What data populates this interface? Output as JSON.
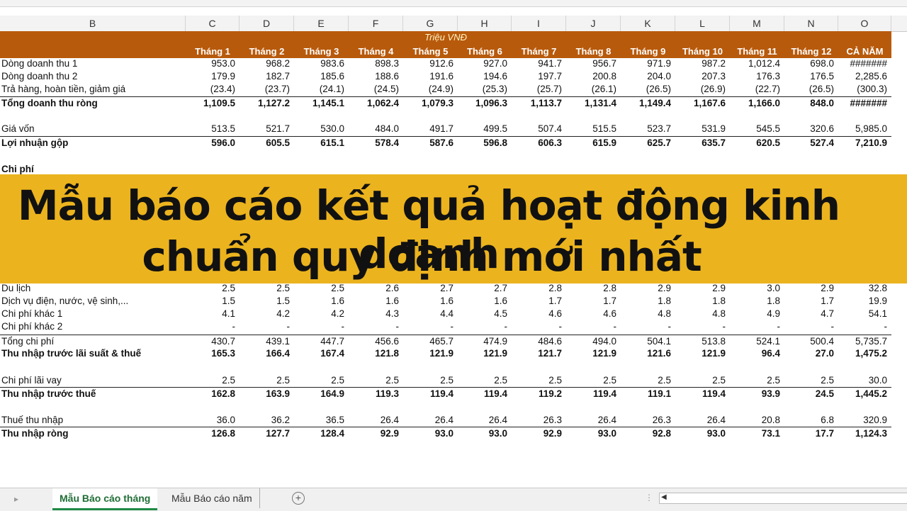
{
  "columns": [
    "B",
    "C",
    "D",
    "E",
    "F",
    "G",
    "H",
    "I",
    "J",
    "K",
    "L",
    "M",
    "N",
    "O"
  ],
  "unit_label": "Triệu VNĐ",
  "month_headers": [
    "Tháng 1",
    "Tháng 2",
    "Tháng 3",
    "Tháng 4",
    "Tháng 5",
    "Tháng 6",
    "Tháng 7",
    "Tháng 8",
    "Tháng 9",
    "Tháng 10",
    "Tháng 11",
    "Tháng 12",
    "CẢ NĂM"
  ],
  "rows_top": [
    {
      "label": "Dòng doanh thu 1",
      "values": [
        "953.0",
        "968.2",
        "983.6",
        "898.3",
        "912.6",
        "927.0",
        "941.7",
        "956.7",
        "971.9",
        "987.2",
        "1,012.4",
        "698.0",
        "#######"
      ]
    },
    {
      "label": "Dòng doanh thu 2",
      "values": [
        "179.9",
        "182.7",
        "185.6",
        "188.6",
        "191.6",
        "194.6",
        "197.7",
        "200.8",
        "204.0",
        "207.3",
        "176.3",
        "176.5",
        "2,285.6"
      ]
    },
    {
      "label": "Trả hàng, hoàn tiền, giảm giá",
      "values": [
        "(23.4)",
        "(23.7)",
        "(24.1)",
        "(24.5)",
        "(24.9)",
        "(25.3)",
        "(25.7)",
        "(26.1)",
        "(26.5)",
        "(26.9)",
        "(22.7)",
        "(26.5)",
        "(300.3)"
      ]
    },
    {
      "label": "Tổng doanh thu ròng",
      "values": [
        "1,109.5",
        "1,127.2",
        "1,145.1",
        "1,062.4",
        "1,079.3",
        "1,096.3",
        "1,113.7",
        "1,131.4",
        "1,149.4",
        "1,167.6",
        "1,166.0",
        "848.0",
        "#######"
      ]
    },
    {
      "label": "Giá vốn",
      "values": [
        "513.5",
        "521.7",
        "530.0",
        "484.0",
        "491.7",
        "499.5",
        "507.4",
        "515.5",
        "523.7",
        "531.9",
        "545.5",
        "320.6",
        "5,985.0"
      ]
    },
    {
      "label": "Lợi nhuận gộp",
      "values": [
        "596.0",
        "605.5",
        "615.1",
        "578.4",
        "587.6",
        "596.8",
        "606.3",
        "615.9",
        "625.7",
        "635.7",
        "620.5",
        "527.4",
        "7,210.9"
      ]
    },
    {
      "label": "Chi phí",
      "values": []
    }
  ],
  "rows_bottom": [
    {
      "label": "Du lịch",
      "values": [
        "2.5",
        "2.5",
        "2.5",
        "2.6",
        "2.7",
        "2.7",
        "2.8",
        "2.8",
        "2.9",
        "2.9",
        "3.0",
        "2.9",
        "32.8"
      ]
    },
    {
      "label": "Dịch vụ điện, nước, vệ sinh,...",
      "values": [
        "1.5",
        "1.5",
        "1.6",
        "1.6",
        "1.6",
        "1.6",
        "1.7",
        "1.7",
        "1.8",
        "1.8",
        "1.8",
        "1.7",
        "19.9"
      ]
    },
    {
      "label": "Chi phí khác 1",
      "values": [
        "4.1",
        "4.2",
        "4.2",
        "4.3",
        "4.4",
        "4.5",
        "4.6",
        "4.6",
        "4.8",
        "4.8",
        "4.9",
        "4.7",
        "54.1"
      ]
    },
    {
      "label": "Chi phí khác 2",
      "values": [
        "-",
        "-",
        "-",
        "-",
        "-",
        "-",
        "-",
        "-",
        "-",
        "-",
        "-",
        "-",
        "-"
      ]
    },
    {
      "label": "Tổng chi phí",
      "values": [
        "430.7",
        "439.1",
        "447.7",
        "456.6",
        "465.7",
        "474.9",
        "484.6",
        "494.0",
        "504.1",
        "513.8",
        "524.1",
        "500.4",
        "5,735.7"
      ]
    },
    {
      "label": "Thu nhập trước lãi suất & thuế",
      "values": [
        "165.3",
        "166.4",
        "167.4",
        "121.8",
        "121.9",
        "121.9",
        "121.7",
        "121.9",
        "121.6",
        "121.9",
        "96.4",
        "27.0",
        "1,475.2"
      ]
    },
    {
      "label": "Chi phí lãi vay",
      "values": [
        "2.5",
        "2.5",
        "2.5",
        "2.5",
        "2.5",
        "2.5",
        "2.5",
        "2.5",
        "2.5",
        "2.5",
        "2.5",
        "2.5",
        "30.0"
      ]
    },
    {
      "label": "Thu nhập trước thuế",
      "values": [
        "162.8",
        "163.9",
        "164.9",
        "119.3",
        "119.4",
        "119.4",
        "119.2",
        "119.4",
        "119.1",
        "119.4",
        "93.9",
        "24.5",
        "1,445.2"
      ]
    },
    {
      "label": "Thuế thu nhập",
      "values": [
        "36.0",
        "36.2",
        "36.5",
        "26.4",
        "26.4",
        "26.4",
        "26.3",
        "26.4",
        "26.3",
        "26.4",
        "20.8",
        "6.8",
        "320.9"
      ]
    },
    {
      "label": "Thu nhập ròng",
      "values": [
        "126.8",
        "127.7",
        "128.4",
        "92.9",
        "93.0",
        "93.0",
        "92.9",
        "93.0",
        "92.8",
        "93.0",
        "73.1",
        "17.7",
        "1,124.3"
      ]
    }
  ],
  "banner": {
    "line1": "Mẫu báo cáo kết quả hoạt động kinh doanh",
    "line2": "chuẩn quy định mới nhất"
  },
  "sheet_tabs": {
    "active": "Mẫu Báo cáo tháng",
    "inactive": "Mẫu Báo cáo năm"
  },
  "colors": {
    "header_band": "#b85a0c",
    "banner": "#ebb31e",
    "active_tab": "#1f8a45"
  }
}
